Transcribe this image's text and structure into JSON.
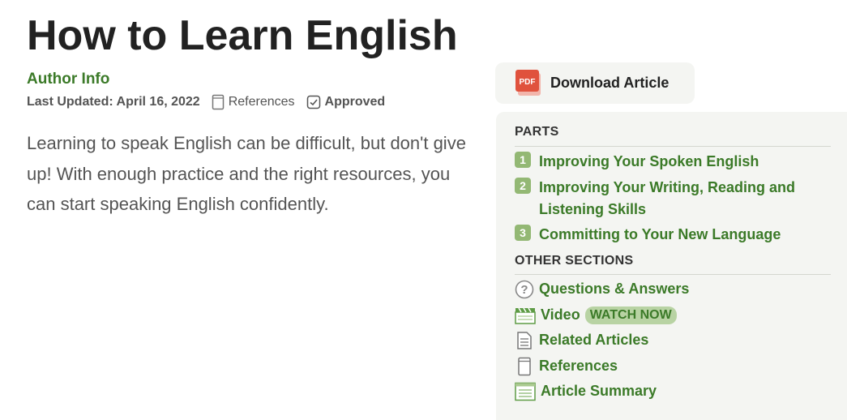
{
  "article": {
    "title": "How to Learn English",
    "author_link": "Author Info",
    "last_updated": "Last Updated: April 16, 2022",
    "references_label": "References",
    "approved_label": "Approved",
    "intro": "Learning to speak English can be difficult, but don't give up! With enough practice and the right resources, you can start speaking English confidently."
  },
  "download": {
    "label": "Download Article",
    "icon": "pdf-icon",
    "icon_text": "PDF"
  },
  "toc": {
    "parts_heading": "PARTS",
    "parts": [
      {
        "num": "1",
        "label": "Improving Your Spoken English"
      },
      {
        "num": "2",
        "label": "Improving Your Writing, Reading and Listening Skills"
      },
      {
        "num": "3",
        "label": "Committing to Your New Language"
      }
    ],
    "other_heading": "OTHER SECTIONS",
    "sections": [
      {
        "label": "Questions & Answers",
        "icon": "question-icon"
      },
      {
        "label": "Video",
        "icon": "clapperboard-icon",
        "badge": "WATCH NOW"
      },
      {
        "label": "Related Articles",
        "icon": "document-icon"
      },
      {
        "label": "References",
        "icon": "book-icon"
      },
      {
        "label": "Article Summary",
        "icon": "summary-icon"
      }
    ]
  },
  "colors": {
    "link_green": "#3b7a28",
    "badge_green": "#93b874",
    "panel_bg": "#f4f5f2",
    "pdf_red": "#e0523d"
  }
}
